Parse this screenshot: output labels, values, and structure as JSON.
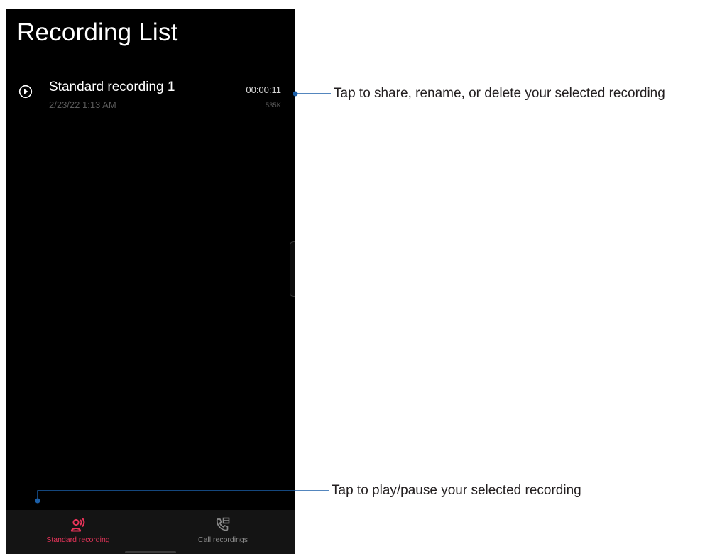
{
  "app": {
    "title": "Recording List"
  },
  "recordings": [
    {
      "name": "Standard recording 1",
      "date": "2/23/22 1:13 AM",
      "duration": "00:00:11",
      "size": "535K",
      "icon": "play-circle-icon"
    }
  ],
  "bottom_nav": {
    "tabs": [
      {
        "label": "Standard recording",
        "icon": "voice-recording-icon",
        "active": true
      },
      {
        "label": "Call recordings",
        "icon": "call-recording-icon",
        "active": false
      }
    ]
  },
  "callouts": {
    "share_rename_delete": "Tap to share, rename, or delete your selected recording",
    "play_pause": "Tap to play/pause your selected recording"
  },
  "colors": {
    "background": "#000000",
    "accent": "#e8345a",
    "callout_line": "#1b5fa8",
    "inactive": "#8a8a8a"
  }
}
